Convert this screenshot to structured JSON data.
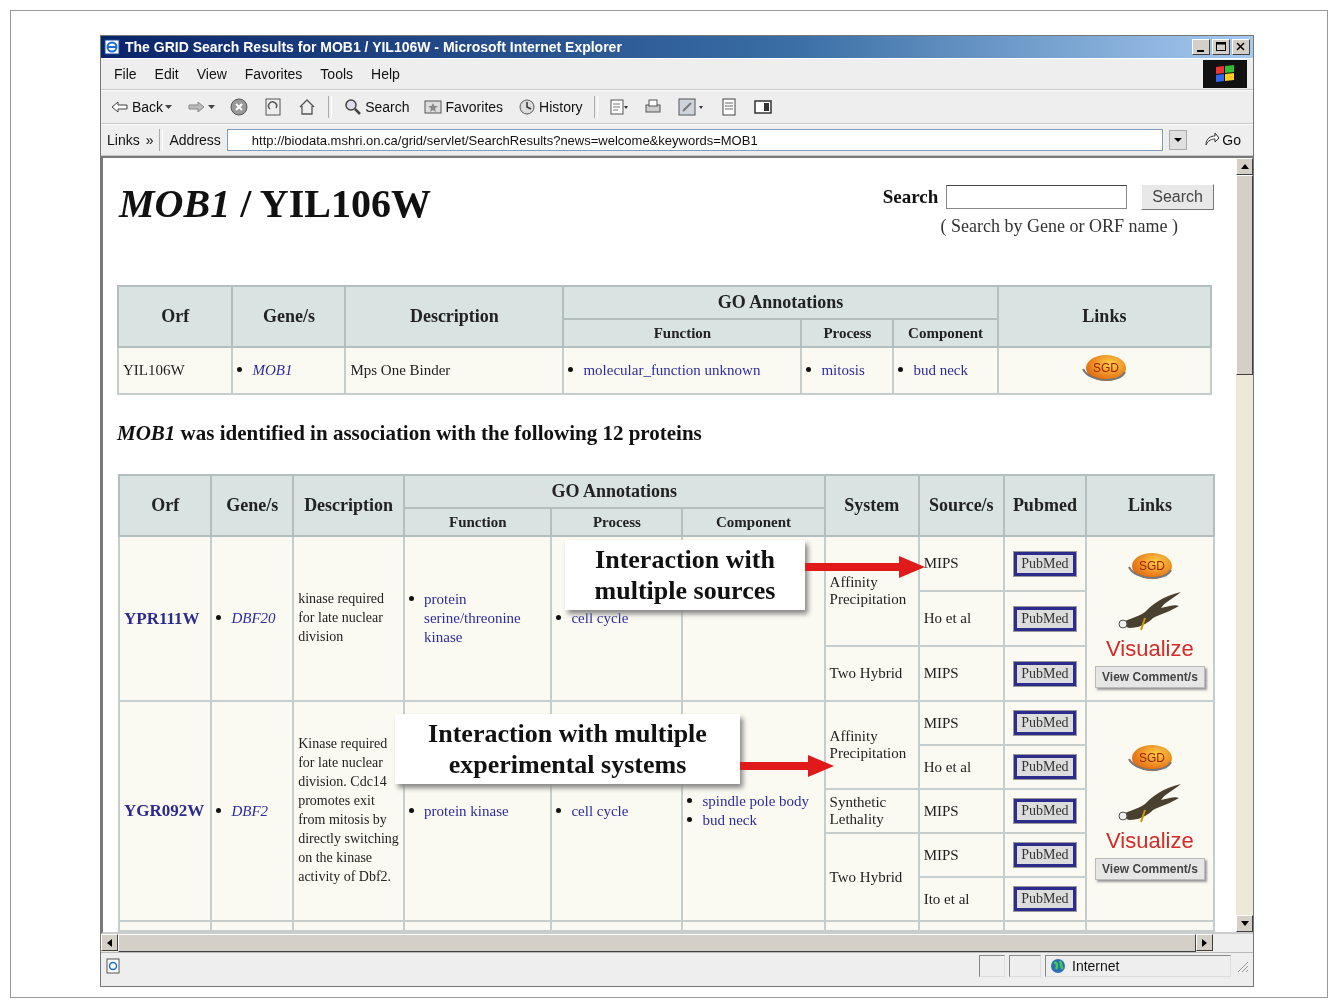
{
  "window": {
    "title": "The GRID Search Results for MOB1 / YIL106W - Microsoft Internet Explorer"
  },
  "menu": [
    "File",
    "Edit",
    "View",
    "Favorites",
    "Tools",
    "Help"
  ],
  "toolbar": [
    {
      "kind": "back",
      "label": "Back"
    },
    {
      "kind": "forward"
    },
    {
      "kind": "stop"
    },
    {
      "kind": "refresh"
    },
    {
      "kind": "home"
    },
    {
      "kind": "search",
      "label": "Search"
    },
    {
      "kind": "favorites",
      "label": "Favorites"
    },
    {
      "kind": "history",
      "label": "History"
    },
    {
      "kind": "mail"
    },
    {
      "kind": "print"
    },
    {
      "kind": "edit"
    },
    {
      "kind": "discuss"
    },
    {
      "kind": "messenger"
    }
  ],
  "address_bar": {
    "links_label": "Links",
    "chevron": "»",
    "address_label": "Address",
    "url": "http://biodata.mshri.on.ca/grid/servlet/SearchResults?news=welcome&keywords=MOB1",
    "go_label": "Go"
  },
  "page": {
    "heading": "*MOB1* / YIL106W",
    "search": {
      "label": "Search",
      "button": "Search",
      "hint": "( Search by Gene or ORF name )"
    }
  },
  "summary_table": {
    "columns": [
      {
        "label": "Orf"
      },
      {
        "label": "Gene/s"
      },
      {
        "label": "Description"
      },
      {
        "label": "GO Annotations",
        "children": [
          "Function",
          "Process",
          "Component"
        ]
      },
      {
        "label": "Links"
      }
    ],
    "rows": [
      {
        "orf": "YIL106W",
        "genes": [
          "MOB1"
        ],
        "description": "Mps One Binder",
        "function": [
          "molecular_function unknown"
        ],
        "process": [
          "mitosis"
        ],
        "component": [
          "bud neck"
        ],
        "logo": "SGD"
      }
    ]
  },
  "interactions_intro": "*MOB1* was identified in association with the following 12 proteins",
  "interactions_table": {
    "columns": [
      {
        "label": "Orf"
      },
      {
        "label": "Gene/s"
      },
      {
        "label": "Description"
      },
      {
        "label": "GO Annotations",
        "children": [
          "Function",
          "Process",
          "Component"
        ]
      },
      {
        "label": "System"
      },
      {
        "label": "Source/s"
      },
      {
        "label": "Pubmed"
      },
      {
        "label": "Links"
      }
    ],
    "rows": [
      {
        "orf": "YPR111W",
        "genes": [
          "DBF20"
        ],
        "description": "kinase required for late nuclear division",
        "function": [
          "protein serine/threonine kinase"
        ],
        "process": [
          "cell cycle"
        ],
        "systems": [
          {
            "name": "Affinity Precipitation",
            "sources": [
              {
                "source": "MIPS",
                "pubmed": "PubMed"
              },
              {
                "source": "Ho et al",
                "pubmed": "PubMed"
              }
            ]
          },
          {
            "name": "Two Hybrid",
            "sources": [
              {
                "source": "MIPS",
                "pubmed": "PubMed"
              }
            ]
          }
        ],
        "links": {
          "logo": "SGD",
          "visualize": "Visualize",
          "comments": "View Comment/s"
        }
      },
      {
        "orf": "YGR092W",
        "genes": [
          "DBF2"
        ],
        "description": "Kinase required for late nuclear division. Cdc14 promotes exit from mitosis by directly switching on the kinase activity of Dbf2.",
        "function": [
          "protein kinase"
        ],
        "process": [
          "cell cycle"
        ],
        "component": [
          "spindle pole body",
          "bud neck"
        ],
        "systems": [
          {
            "name": "Affinity Precipitation",
            "sources": [
              {
                "source": "MIPS",
                "pubmed": "PubMed"
              },
              {
                "source": "Ho et al",
                "pubmed": "PubMed"
              }
            ]
          },
          {
            "name": "Synthetic Lethality",
            "sources": [
              {
                "source": "MIPS",
                "pubmed": "PubMed"
              }
            ]
          },
          {
            "name": "Two Hybrid",
            "sources": [
              {
                "source": "MIPS",
                "pubmed": "PubMed"
              },
              {
                "source": "Ito et al",
                "pubmed": "PubMed"
              }
            ]
          }
        ],
        "links": {
          "logo": "SGD",
          "visualize": "Visualize",
          "comments": "View Comment/s"
        }
      }
    ]
  },
  "callouts": [
    "Interaction with multiple sources",
    "Interaction with multiple experimental systems"
  ],
  "status_bar": {
    "zone": "Internet"
  }
}
